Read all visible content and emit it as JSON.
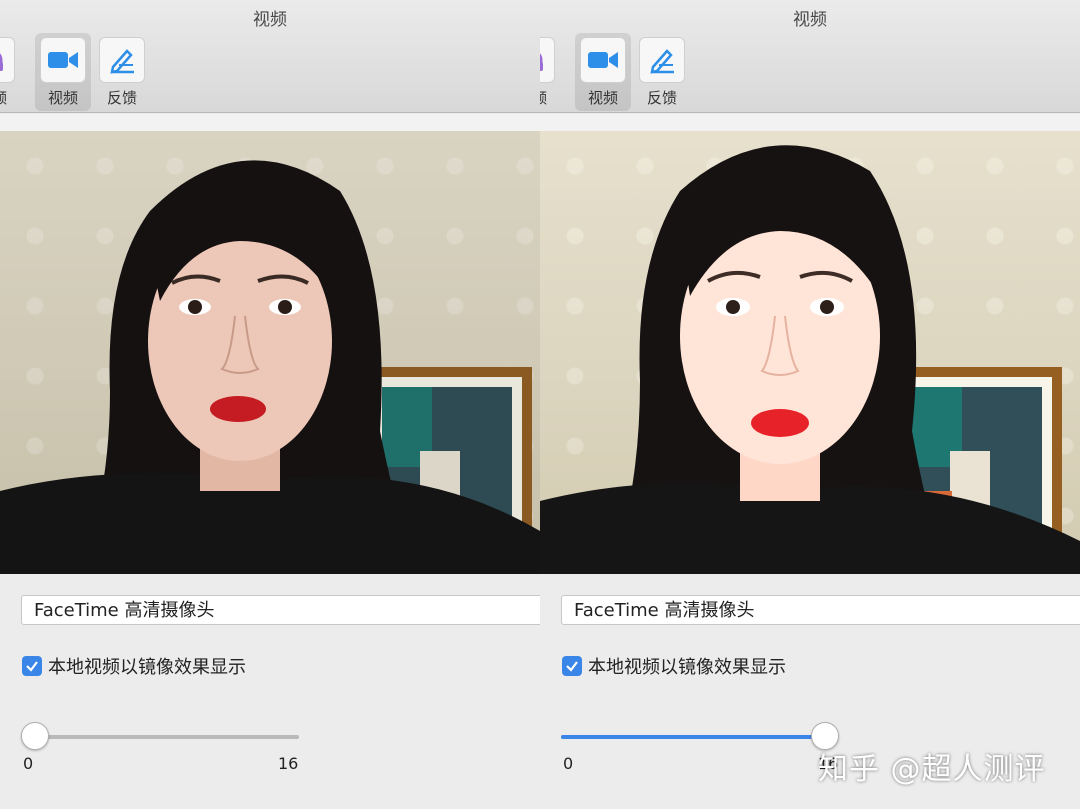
{
  "panels": [
    {
      "window_title": "视频",
      "toolbar": [
        {
          "label": "音频",
          "icon": "headphones-icon",
          "active": false
        },
        {
          "label": "视频",
          "icon": "video-camera-icon",
          "active": true
        },
        {
          "label": "反馈",
          "icon": "feedback-pen-icon",
          "active": false
        }
      ],
      "camera_device": "FaceTime 高清摄像头",
      "mirror_checkbox": {
        "label": "本地视频以镜像效果显示",
        "checked": true
      },
      "slider": {
        "min": 0,
        "max": 16,
        "value": 0,
        "min_label": "0",
        "max_label": "16"
      }
    },
    {
      "window_title": "视频",
      "toolbar": [
        {
          "label": "音频",
          "icon": "headphones-icon",
          "active": false
        },
        {
          "label": "视频",
          "icon": "video-camera-icon",
          "active": true
        },
        {
          "label": "反馈",
          "icon": "feedback-pen-icon",
          "active": false
        }
      ],
      "camera_device": "FaceTime 高清摄像头",
      "mirror_checkbox": {
        "label": "本地视频以镜像效果显示",
        "checked": true
      },
      "slider": {
        "min": 0,
        "max": 16,
        "value": 16,
        "min_label": "0",
        "max_label": "16"
      }
    }
  ],
  "watermark": "知乎 @超人测评",
  "colors": {
    "accent": "#3a86e8",
    "audio_icon": "#9b6bd6"
  }
}
